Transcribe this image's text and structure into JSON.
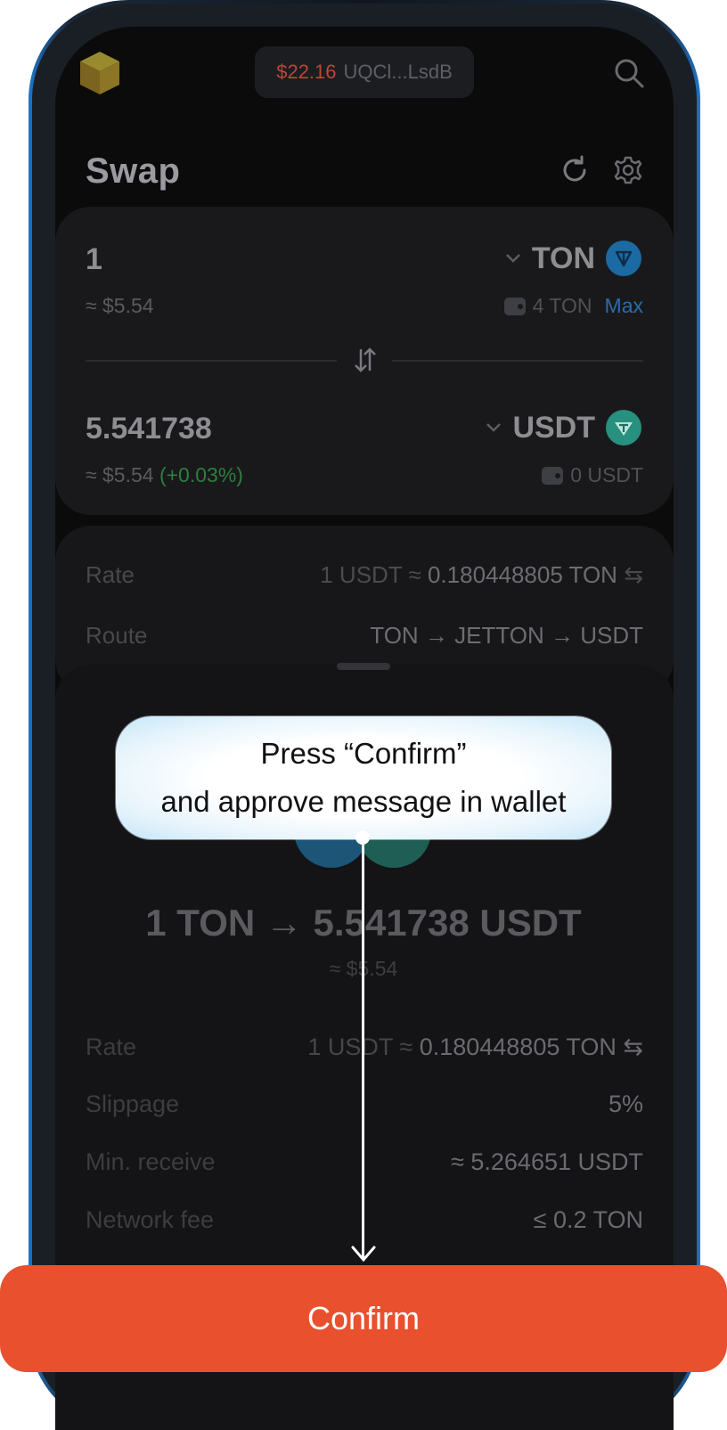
{
  "header": {
    "balance": "$22.16",
    "address": "UQCl...LsdB"
  },
  "swap": {
    "title": "Swap",
    "from": {
      "amount": "1",
      "usd": "≈ $5.54",
      "token": "TON",
      "balance": "4 TON",
      "max_label": "Max"
    },
    "to": {
      "amount": "5.541738",
      "usd": "≈ $5.54",
      "change": "(+0.03%)",
      "token": "USDT",
      "balance": "0 USDT"
    }
  },
  "info": {
    "rate_label": "Rate",
    "rate_prefix": "1 USDT ≈",
    "rate_value": "0.180448805 TON",
    "route_label": "Route",
    "route_value": "TON → JETTON → USDT"
  },
  "confirm_sheet": {
    "pair_summary": "1 TON → 5.541738 USDT",
    "usd": "≈ $5.54",
    "rows": [
      {
        "label": "Rate",
        "prefix": "1 USDT ≈",
        "value": "0.180448805 TON ⇆"
      },
      {
        "label": "Slippage",
        "prefix": "",
        "value": "5%"
      },
      {
        "label": "Min. receive",
        "prefix": "",
        "value": "≈ 5.264651 USDT"
      },
      {
        "label": "Network fee",
        "prefix": "",
        "value": "≤ 0.2 TON"
      }
    ]
  },
  "callout": {
    "line1": "Press “Confirm”",
    "line2": "and approve message in wallet"
  },
  "confirm_button": {
    "label": "Confirm"
  },
  "colors": {
    "accent": "#e9502d",
    "ton": "#1c6aa3",
    "usdt": "#27907f",
    "positive": "#2e7f3c",
    "link": "#2a6cb0"
  },
  "icons": [
    "cube-logo-icon",
    "search-icon",
    "refresh-icon",
    "gear-icon",
    "chevron-down-icon",
    "ton-icon",
    "usdt-icon",
    "wallet-icon",
    "swap-arrows-icon",
    "swap-direction-icon"
  ]
}
